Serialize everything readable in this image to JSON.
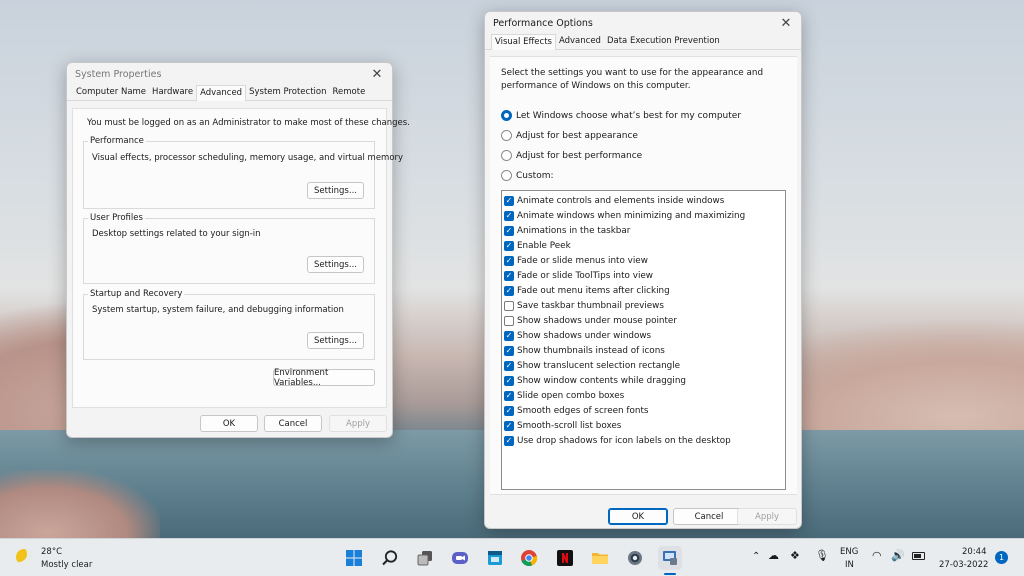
{
  "sysprops": {
    "title": "System Properties",
    "tabs": [
      "Computer Name",
      "Hardware",
      "Advanced",
      "System Protection",
      "Remote"
    ],
    "admin_note": "You must be logged on as an Administrator to make most of these changes.",
    "performance": {
      "title": "Performance",
      "desc": "Visual effects, processor scheduling, memory usage, and virtual memory",
      "button": "Settings..."
    },
    "profiles": {
      "title": "User Profiles",
      "desc": "Desktop settings related to your sign-in",
      "button": "Settings..."
    },
    "startup": {
      "title": "Startup and Recovery",
      "desc": "System startup, system failure, and debugging information",
      "button": "Settings..."
    },
    "env_button": "Environment Variables...",
    "ok": "OK",
    "cancel": "Cancel",
    "apply": "Apply"
  },
  "perf": {
    "title": "Performance Options",
    "tabs": [
      "Visual Effects",
      "Advanced",
      "Data Execution Prevention"
    ],
    "intro": "Select the settings you want to use for the appearance and performance of Windows on this computer.",
    "radios": [
      {
        "label": "Let Windows choose what’s best for my computer",
        "selected": true
      },
      {
        "label": "Adjust for best appearance",
        "selected": false
      },
      {
        "label": "Adjust for best performance",
        "selected": false
      },
      {
        "label": "Custom:",
        "selected": false
      }
    ],
    "options": [
      {
        "label": "Animate controls and elements inside windows",
        "checked": true
      },
      {
        "label": "Animate windows when minimizing and maximizing",
        "checked": true
      },
      {
        "label": "Animations in the taskbar",
        "checked": true
      },
      {
        "label": "Enable Peek",
        "checked": true
      },
      {
        "label": "Fade or slide menus into view",
        "checked": true
      },
      {
        "label": "Fade or slide ToolTips into view",
        "checked": true
      },
      {
        "label": "Fade out menu items after clicking",
        "checked": true
      },
      {
        "label": "Save taskbar thumbnail previews",
        "checked": false
      },
      {
        "label": "Show shadows under mouse pointer",
        "checked": false
      },
      {
        "label": "Show shadows under windows",
        "checked": true
      },
      {
        "label": "Show thumbnails instead of icons",
        "checked": true
      },
      {
        "label": "Show translucent selection rectangle",
        "checked": true
      },
      {
        "label": "Show window contents while dragging",
        "checked": true
      },
      {
        "label": "Slide open combo boxes",
        "checked": true
      },
      {
        "label": "Smooth edges of screen fonts",
        "checked": true
      },
      {
        "label": "Smooth-scroll list boxes",
        "checked": true
      },
      {
        "label": "Use drop shadows for icon labels on the desktop",
        "checked": true
      }
    ],
    "ok": "OK",
    "cancel": "Cancel",
    "apply": "Apply"
  },
  "taskbar": {
    "weather_temp": "28°C",
    "weather_desc": "Mostly clear",
    "apps": [
      "start-icon",
      "search-icon",
      "task-view-icon",
      "chat-icon",
      "store-icon",
      "chrome-icon",
      "netflix-icon",
      "file-explorer-icon",
      "settings-icon",
      "system-properties-icon"
    ],
    "lang": "ENG",
    "region": "IN",
    "time": "20:44",
    "date": "27-03-2022",
    "notifications": "1"
  }
}
